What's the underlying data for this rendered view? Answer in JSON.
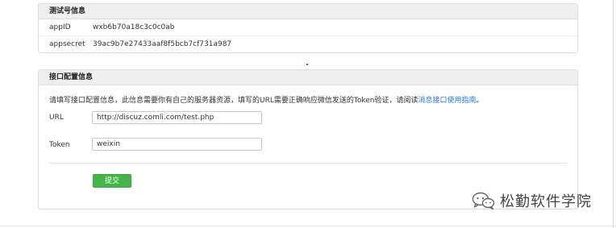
{
  "test_account": {
    "header": "测试号信息",
    "rows": [
      {
        "label": "appID",
        "value": "wxb6b70a18c3c0c0ab"
      },
      {
        "label": "appsecret",
        "value": "39ac9b7e27433aaf8f5bcb7cf731a987"
      }
    ]
  },
  "interface_config": {
    "header": "接口配置信息",
    "description": "请填写接口配置信息，此信息需要你有自己的服务器资源，填写的URL需要正确响应微信发送的Token验证，请阅读",
    "description_link": "消息接口使用指南",
    "description_end": "。",
    "url_label": "URL",
    "url_value": "http://discuz.comli.com/test.php",
    "token_label": "Token",
    "token_value": "weixin",
    "submit_label": "提交"
  },
  "watermark": {
    "text": "松勤软件学院",
    "icon": "wechat-icon"
  },
  "colors": {
    "submit": "#44b549",
    "link": "#2b7bd0",
    "panel_header_bg": "#efefef"
  }
}
